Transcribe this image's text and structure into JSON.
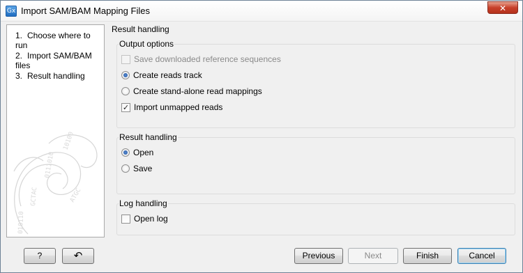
{
  "window": {
    "title": "Import SAM/BAM Mapping Files",
    "app_icon_text": "Gx",
    "close_glyph": "✕"
  },
  "steps": [
    {
      "num": "1.",
      "label": "Choose where to run"
    },
    {
      "num": "2.",
      "label": "Import SAM/BAM files"
    },
    {
      "num": "3.",
      "label": "Result handling"
    }
  ],
  "content": {
    "title": "Result handling",
    "output_options": {
      "title": "Output options",
      "save_reference": {
        "label": "Save downloaded reference sequences",
        "checked": false,
        "disabled": true
      },
      "create_reads_track": {
        "label": "Create reads track",
        "selected": true
      },
      "create_standalone": {
        "label": "Create stand-alone read mappings",
        "selected": false
      },
      "import_unmapped": {
        "label": "Import unmapped reads",
        "checked": true
      }
    },
    "result_handling": {
      "title": "Result handling",
      "open": {
        "label": "Open",
        "selected": true
      },
      "save": {
        "label": "Save",
        "selected": false
      }
    },
    "log_handling": {
      "title": "Log handling",
      "open_log": {
        "label": "Open log",
        "checked": false
      }
    }
  },
  "footer": {
    "help_label": "?",
    "reset_glyph": "↶",
    "previous_label": "Previous",
    "next_label": "Next",
    "finish_label": "Finish",
    "cancel_label": "Cancel"
  }
}
